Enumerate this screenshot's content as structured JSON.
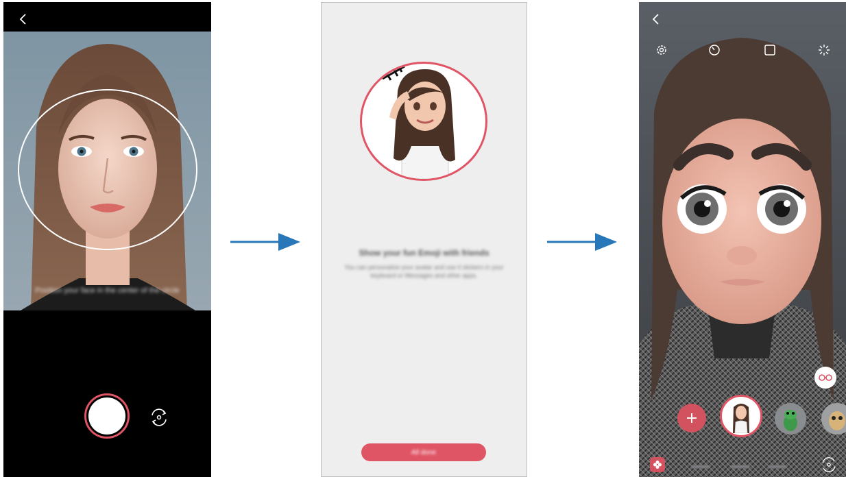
{
  "screens": {
    "capture": {
      "instruction": "Position your face in the center of the circle"
    },
    "intro": {
      "title": "Show your fun Emoji with friends",
      "body": "You can personalize your avatar and use it stickers in your keyboard or Messages and other apps.",
      "button_label": "All done"
    },
    "ar_camera": {
      "modes": [
        "",
        "",
        ""
      ]
    }
  },
  "icons": {
    "back": "chevron-left-icon",
    "switch_camera": "switch-camera-icon",
    "settings": "gear-icon",
    "timer": "timer-icon",
    "aspect": "aspect-ratio-icon",
    "flash": "flash-off-icon",
    "add": "plus-icon",
    "glasses": "glasses-icon",
    "bixby": "flower-icon"
  },
  "colors": {
    "accent": "#e05566",
    "flow_arrow": "#2877b8"
  }
}
